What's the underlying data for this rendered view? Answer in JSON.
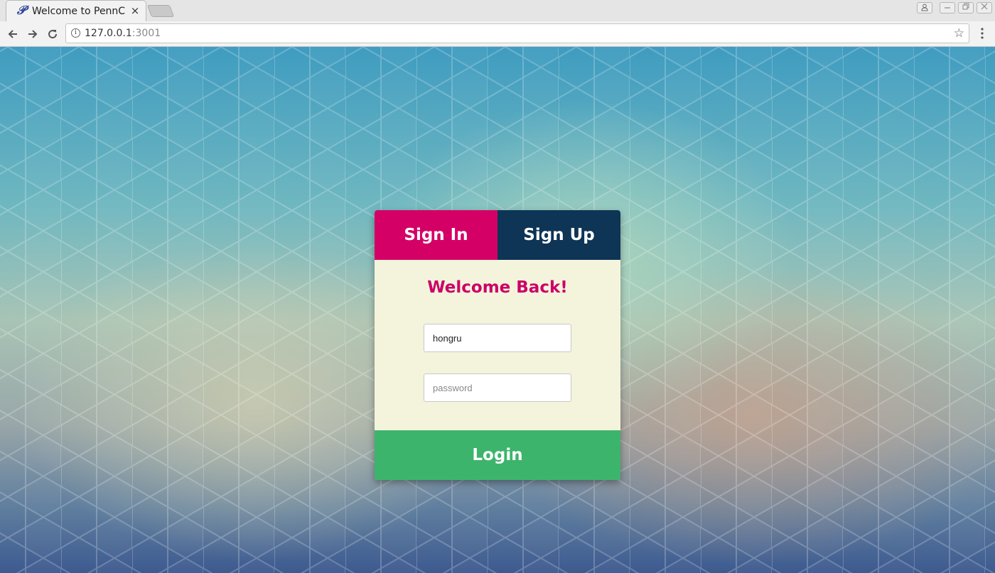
{
  "browser": {
    "tab_title": "Welcome to PennCl",
    "tab_close": "×",
    "favicon": "𝒫",
    "url_host": "127.0.0.1",
    "url_port": ":3001",
    "icons": {
      "back": "back-arrow-icon",
      "forward": "forward-arrow-icon",
      "reload": "reload-icon",
      "info": "info-icon",
      "star": "bookmark-star-icon",
      "menu": "kebab-menu-icon"
    }
  },
  "auth": {
    "tabs": {
      "signin_label": "Sign In",
      "signup_label": "Sign Up"
    },
    "heading": "Welcome Back!",
    "username_value": "hongru",
    "password_placeholder": "password",
    "login_label": "Login"
  },
  "colors": {
    "signin_tab": "#d40066",
    "signup_tab": "#0e3456",
    "card_bg": "#f4f4dd",
    "heading": "#cc0066",
    "login_button": "#3db46c"
  }
}
